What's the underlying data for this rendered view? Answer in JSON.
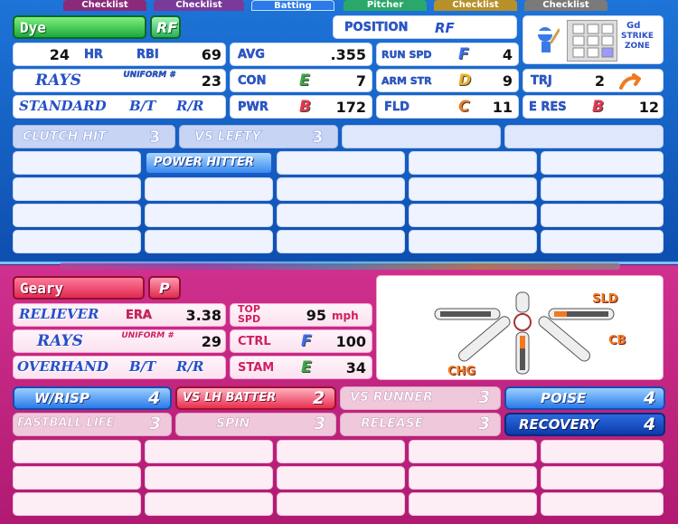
{
  "batter": {
    "tabs": [
      "Checklist",
      "Checklist",
      "Batting",
      "Pitcher",
      "Checklist",
      "Checklist"
    ],
    "name": "Dye",
    "position_badge": "RF",
    "position_label": "POSITION",
    "position_value": "RF",
    "hr_value": "24",
    "hr_label": "HR",
    "rbi_label": "RBI",
    "rbi_value": "69",
    "avg_label": "AVG",
    "avg_value": ".355",
    "runspd_label": "RUN SPD",
    "runspd_grade": "F",
    "runspd_value": "4",
    "team": "RAYS",
    "uniform_label": "UNIFORM #",
    "uniform_value": "23",
    "con_label": "CON",
    "con_grade": "E",
    "con_value": "7",
    "armstr_label": "ARM STR",
    "armstr_grade": "D",
    "armstr_value": "9",
    "trj_label": "TRJ",
    "trj_value": "2",
    "stance": "STANDARD",
    "bt_label": "B/T",
    "bt_value": "R/R",
    "pwr_label": "PWR",
    "pwr_grade": "B",
    "pwr_value": "172",
    "fld_label": "FLD",
    "fld_grade": "C",
    "fld_value": "11",
    "eres_label": "E RES",
    "eres_grade": "B",
    "eres_value": "12",
    "zone_label_1": "Gd",
    "zone_label_2": "STRIKE",
    "zone_label_3": "ZONE",
    "abilities": [
      {
        "label": "CLUTCH HIT",
        "value": "3"
      },
      {
        "label": "VS LEFTY",
        "value": "3"
      },
      {
        "label": "POWER HITTER",
        "value": ""
      }
    ]
  },
  "pitcher": {
    "name": "Geary",
    "position_badge": "P",
    "role": "RELIEVER",
    "era_label": "ERA",
    "era_value": "3.38",
    "topspd_label_1": "TOP",
    "topspd_label_2": "SPD",
    "topspd_value": "95",
    "topspd_unit": "mph",
    "team": "RAYS",
    "uniform_label": "UNIFORM #",
    "uniform_value": "29",
    "ctrl_label": "CTRL",
    "ctrl_grade": "F",
    "ctrl_value": "100",
    "delivery": "OVERHAND",
    "bt_label": "B/T",
    "bt_value": "R/R",
    "stam_label": "STAM",
    "stam_grade": "E",
    "stam_value": "34",
    "pitch_sld": "SLD",
    "pitch_cb": "CB",
    "pitch_chg": "CHG",
    "abilities": [
      {
        "label": "W/RISP",
        "value": "4"
      },
      {
        "label": "VS LH BATTER",
        "value": "2"
      },
      {
        "label": "VS RUNNER",
        "value": "3"
      },
      {
        "label": "POISE",
        "value": "4"
      },
      {
        "label": "FASTBALL LIFE",
        "value": "3"
      },
      {
        "label": "SPIN",
        "value": "3"
      },
      {
        "label": "RELEASE",
        "value": "3"
      },
      {
        "label": "RECOVERY",
        "value": "4"
      }
    ]
  },
  "colors": {
    "grade_F": "#3a6ff0",
    "grade_E": "#3aa844",
    "grade_D": "#f0b020",
    "grade_C": "#f07a20",
    "grade_B": "#e83850"
  }
}
